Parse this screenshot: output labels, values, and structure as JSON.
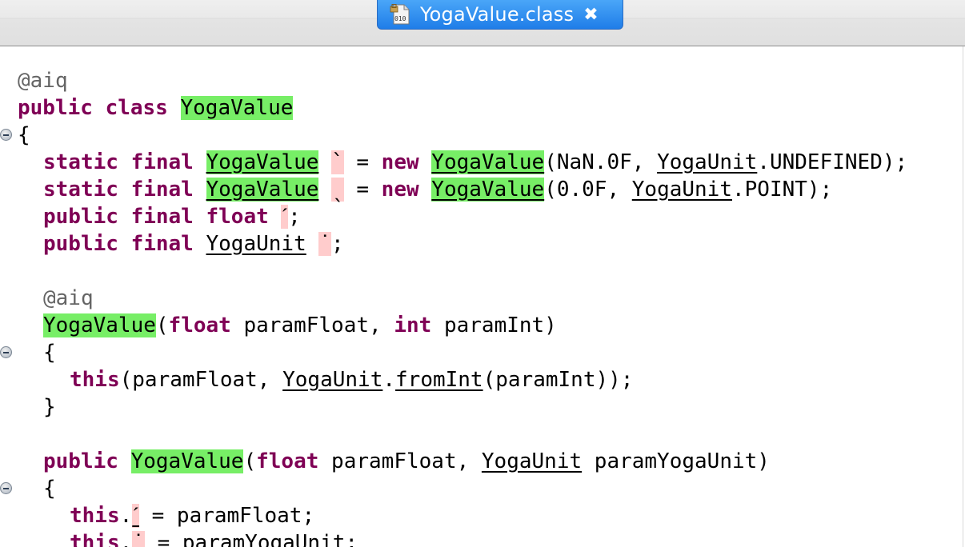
{
  "tab": {
    "title": "YogaValue.class",
    "icon": "class-file-icon",
    "close_icon": "close-icon",
    "close_glyph": "✖"
  },
  "code": {
    "ann1": "@aiq",
    "l2_kw": "public class ",
    "l2_name": "YogaValue",
    "l3": "{",
    "l4_kw": "static final ",
    "l4_type": "YogaValue",
    "l4_field": "`",
    "l4_eq": " = ",
    "l4_new": "new",
    "l4_ctor": "YogaValue",
    "l4_args1": "(NaN.0F, ",
    "l4_unit": "YogaUnit",
    "l4_args2": ".UNDEFINED);",
    "l5_kw": "static final ",
    "l5_type": "YogaValue",
    "l5_field": "ˎ",
    "l5_eq": " = ",
    "l5_new": "new",
    "l5_ctor": "YogaValue",
    "l5_args1": "(0.0F, ",
    "l5_unit": "YogaUnit",
    "l5_args2": ".POINT);",
    "l6_kw": "public final float ",
    "l6_field": "ˊ",
    "l6_end": ";",
    "l7_kw": "public final ",
    "l7_type": "YogaUnit",
    "l7_field": "˙",
    "l7_end": ";",
    "ann2": "@aiq",
    "l10_name": "YogaValue",
    "l10_p1": "(",
    "l10_kw1": "float",
    "l10_p2": " paramFloat, ",
    "l10_kw2": "int",
    "l10_p3": " paramInt)",
    "l11": "{",
    "l12_this": "this",
    "l12_p1": "(paramFloat, ",
    "l12_unit": "YogaUnit",
    "l12_dot": ".",
    "l12_method": "fromInt",
    "l12_p2": "(paramInt));",
    "l13": "}",
    "l15_kw": "public ",
    "l15_name": "YogaValue",
    "l15_p1": "(",
    "l15_kw2": "float",
    "l15_p2": " paramFloat, ",
    "l15_unit": "YogaUnit",
    "l15_p3": " paramYogaUnit)",
    "l16": "{",
    "l17_this": "this",
    "l17_dot": ".",
    "l17_field": "ˊ",
    "l17_rest": " = paramFloat;",
    "l18_this": "this",
    "l18_dot": ".",
    "l18_field": "˙",
    "l18_rest": " = paramYogaUnit;"
  }
}
